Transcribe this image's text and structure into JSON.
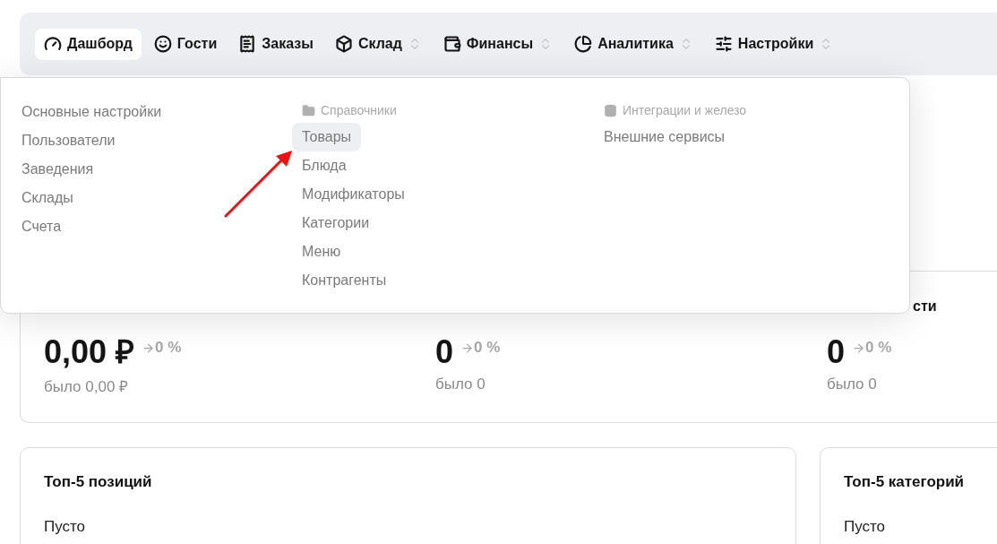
{
  "nav": [
    {
      "label": "Дашборд",
      "selected": true,
      "has_submenu": false
    },
    {
      "label": "Гости",
      "selected": false,
      "has_submenu": false
    },
    {
      "label": "Заказы",
      "selected": false,
      "has_submenu": false
    },
    {
      "label": "Склад",
      "selected": false,
      "has_submenu": true
    },
    {
      "label": "Финансы",
      "selected": false,
      "has_submenu": true
    },
    {
      "label": "Аналитика",
      "selected": false,
      "has_submenu": true
    },
    {
      "label": "Настройки",
      "selected": false,
      "has_submenu": true
    }
  ],
  "dropdown": {
    "columns": [
      {
        "items": [
          {
            "label": "Основные настройки",
            "selected": false
          },
          {
            "label": "Пользователи",
            "selected": false
          },
          {
            "label": "Заведения",
            "selected": false
          },
          {
            "label": "Склады",
            "selected": false
          },
          {
            "label": "Счета",
            "selected": false
          }
        ]
      },
      {
        "header": "Справочники",
        "items": [
          {
            "label": "Товары",
            "selected": true
          },
          {
            "label": "Блюда",
            "selected": false
          },
          {
            "label": "Модификаторы",
            "selected": false
          },
          {
            "label": "Категории",
            "selected": false
          },
          {
            "label": "Меню",
            "selected": false
          },
          {
            "label": "Контрагенты",
            "selected": false
          }
        ]
      },
      {
        "header": "Интеграции и железо",
        "items": [
          {
            "label": "Внешние сервисы",
            "selected": false
          }
        ]
      }
    ]
  },
  "annotation": {
    "kind": "arrow"
  },
  "stats": [
    {
      "value": "0,00 ₽",
      "delta": "0 %",
      "previous": "было 0,00 ₽"
    },
    {
      "value": "0",
      "delta": "0 %",
      "previous": "было 0"
    },
    {
      "title": "сти",
      "value": "0",
      "delta": "0 %",
      "previous": "было 0"
    }
  ],
  "cards": [
    {
      "title": "Топ-5 позиций",
      "text": "Пусто"
    },
    {
      "title": "Топ-5 категорий",
      "text": "Пусто"
    }
  ]
}
